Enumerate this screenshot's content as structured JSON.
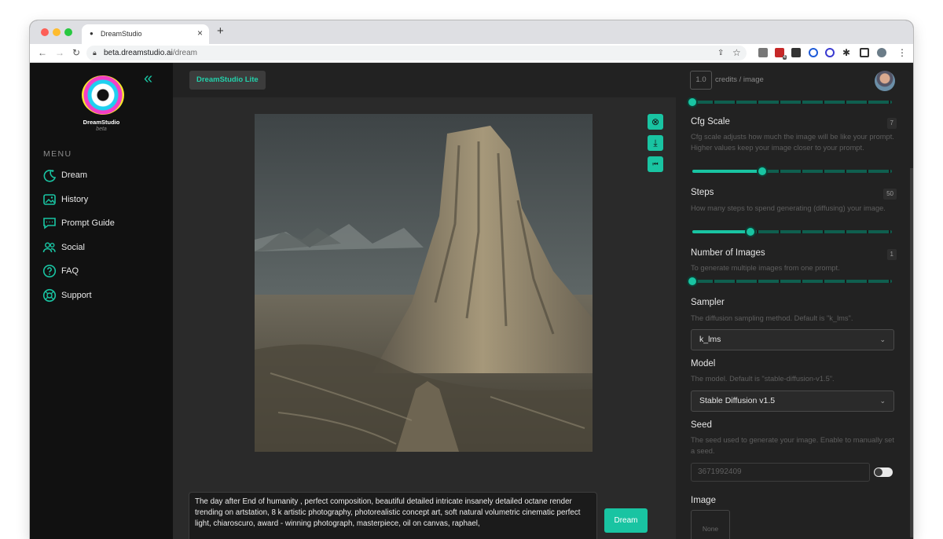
{
  "browser": {
    "tab_title": "DreamStudio",
    "tab_close": "×",
    "new_tab": "+",
    "url_host": "beta.dreamstudio.ai",
    "url_path": "/dream",
    "back": "←",
    "forward": "→",
    "reload": "↻",
    "share": "⇪",
    "star": "☆",
    "menu": "⋮",
    "puzzle": "✱",
    "ext_badge": "4",
    "colors": {
      "red": "#fd5f57",
      "yellow": "#febc2e",
      "green": "#28c840"
    }
  },
  "app": {
    "name": "DreamStudio",
    "beta": "beta",
    "mode_pill": "DreamStudio Lite",
    "collapse_icon": "«",
    "credits_value": "1.0",
    "credits_label": "credits / image",
    "accent": "#19c4a2"
  },
  "sidebar": {
    "menu_label": "MENU",
    "items": [
      {
        "label": "Dream",
        "icon": "moon-sparkle-icon"
      },
      {
        "label": "History",
        "icon": "image-gallery-icon"
      },
      {
        "label": "Prompt Guide",
        "icon": "chat-bubble-icon"
      },
      {
        "label": "Social",
        "icon": "people-icon"
      },
      {
        "label": "FAQ",
        "icon": "question-circle-icon"
      },
      {
        "label": "Support",
        "icon": "lifebuoy-icon"
      }
    ]
  },
  "canvas": {
    "buttons": [
      {
        "name": "cancel-button",
        "icon": "⊗"
      },
      {
        "name": "download-button",
        "icon": "⤓"
      },
      {
        "name": "skip-back-button",
        "icon": "⏮"
      }
    ]
  },
  "prompt": {
    "text": "The day after End of humanity , perfect composition, beautiful detailed intricate insanely detailed octane render trending on artstation, 8 k artistic photography, photorealistic concept art, soft natural volumetric cinematic perfect light, chiaroscuro, award - winning photograph, masterpiece, oil on canvas, raphael,",
    "dream_button": "Dream"
  },
  "settings": {
    "top_slider_value": 0.0,
    "cfg": {
      "title": "Cfg Scale",
      "value": "7",
      "desc": "Cfg scale adjusts how much the image will be like your prompt. Higher values keep your image closer to your prompt.",
      "fraction": 0.35
    },
    "steps": {
      "title": "Steps",
      "value": "50",
      "desc": "How many steps to spend generating (diffusing) your image.",
      "fraction": 0.29
    },
    "num_images": {
      "title": "Number of Images",
      "value": "1",
      "desc": "To generate multiple images from one prompt.",
      "fraction": 0.0
    },
    "sampler": {
      "title": "Sampler",
      "desc": "The diffusion sampling method. Default is \"k_lms\".",
      "selected": "k_lms"
    },
    "model": {
      "title": "Model",
      "desc": "The model. Default is \"stable-diffusion-v1.5\".",
      "selected": "Stable Diffusion v1.5"
    },
    "seed": {
      "title": "Seed",
      "desc": "The seed used to generate your image. Enable to manually set a seed.",
      "value": "3671992409",
      "enabled": false
    },
    "image": {
      "title": "Image",
      "placeholder": "None"
    }
  }
}
